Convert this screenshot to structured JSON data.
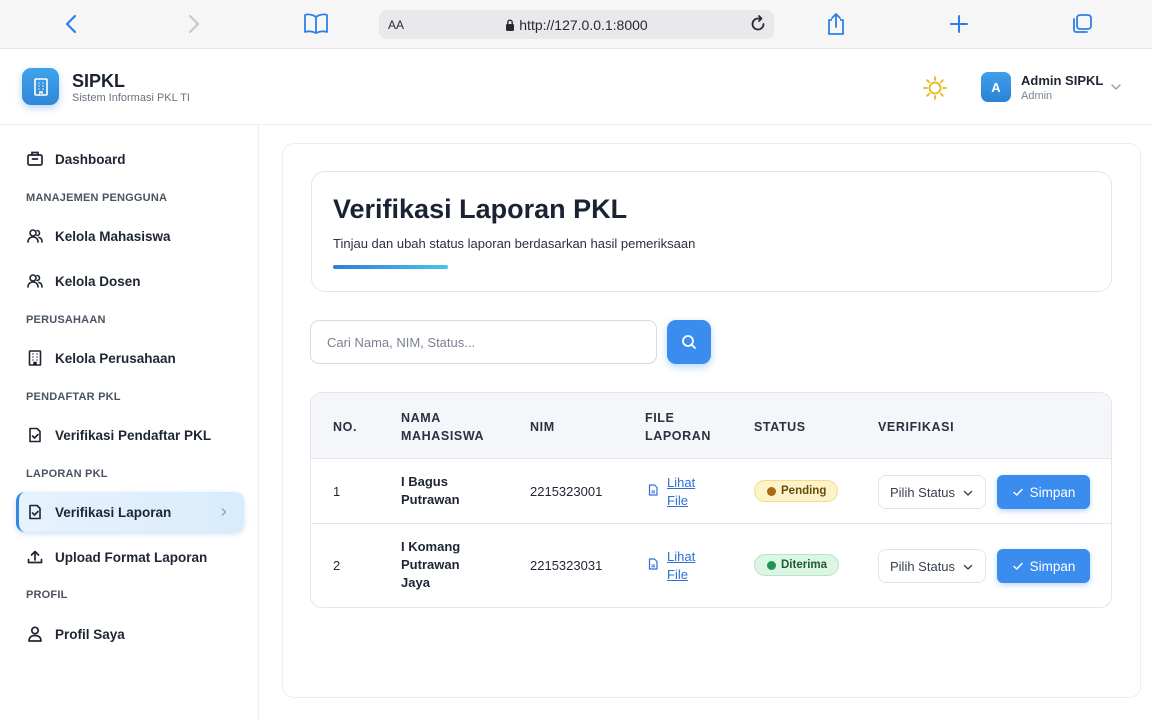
{
  "browser": {
    "font_size_label": "AA",
    "url": "http://127.0.0.1:8000",
    "icons": [
      "back-icon",
      "forward-icon",
      "book-icon",
      "lock-icon",
      "reload-icon",
      "share-icon",
      "plus-icon",
      "tabs-icon"
    ]
  },
  "header": {
    "brand_title": "SIPKL",
    "brand_subtitle": "Sistem Informasi PKL TI",
    "avatar_initial": "A",
    "user_name": "Admin SIPKL",
    "user_role": "Admin"
  },
  "sidebar": {
    "dashboard": "Dashboard",
    "section_users": "MANAJEMEN PENGGUNA",
    "kelola_mahasiswa": "Kelola Mahasiswa",
    "kelola_dosen": "Kelola Dosen",
    "section_company": "PERUSAHAAN",
    "kelola_perusahaan": "Kelola Perusahaan",
    "section_registrant": "PENDAFTAR PKL",
    "verifikasi_pendaftar": "Verifikasi Pendaftar PKL",
    "section_report": "LAPORAN PKL",
    "verifikasi_laporan": "Verifikasi Laporan",
    "upload_format": "Upload Format Laporan",
    "section_profile": "PROFIL",
    "profil_saya": "Profil Saya"
  },
  "page": {
    "title": "Verifikasi Laporan PKL",
    "subtitle": "Tinjau dan ubah status laporan berdasarkan hasil pemeriksaan",
    "search_placeholder": "Cari Nama, NIM, Status..."
  },
  "table": {
    "headers": {
      "no": "NO.",
      "nama_1": "NAMA",
      "nama_2": "MAHASISWA",
      "nim": "NIM",
      "file_1": "FILE",
      "file_2": "LAPORAN",
      "status": "STATUS",
      "verifikasi": "VERIFIKASI"
    },
    "rows": [
      {
        "no": "1",
        "name_lines": [
          "I Bagus",
          "Putrawan"
        ],
        "nim": "2215323001",
        "file_lines": [
          "Lihat",
          "File"
        ],
        "status": "Pending",
        "select_value": "Pilih Status",
        "save_label": "Simpan"
      },
      {
        "no": "2",
        "name_lines": [
          "I Komang",
          "Putrawan",
          "Jaya"
        ],
        "nim": "2215323031",
        "file_lines": [
          "Lihat",
          "File"
        ],
        "status": "Diterima",
        "select_value": "Pilih Status",
        "save_label": "Simpan"
      }
    ]
  },
  "colors": {
    "accent": "#3b8cef",
    "pending_bg": "#fdf3c8",
    "accepted_bg": "#dcf5e4"
  }
}
